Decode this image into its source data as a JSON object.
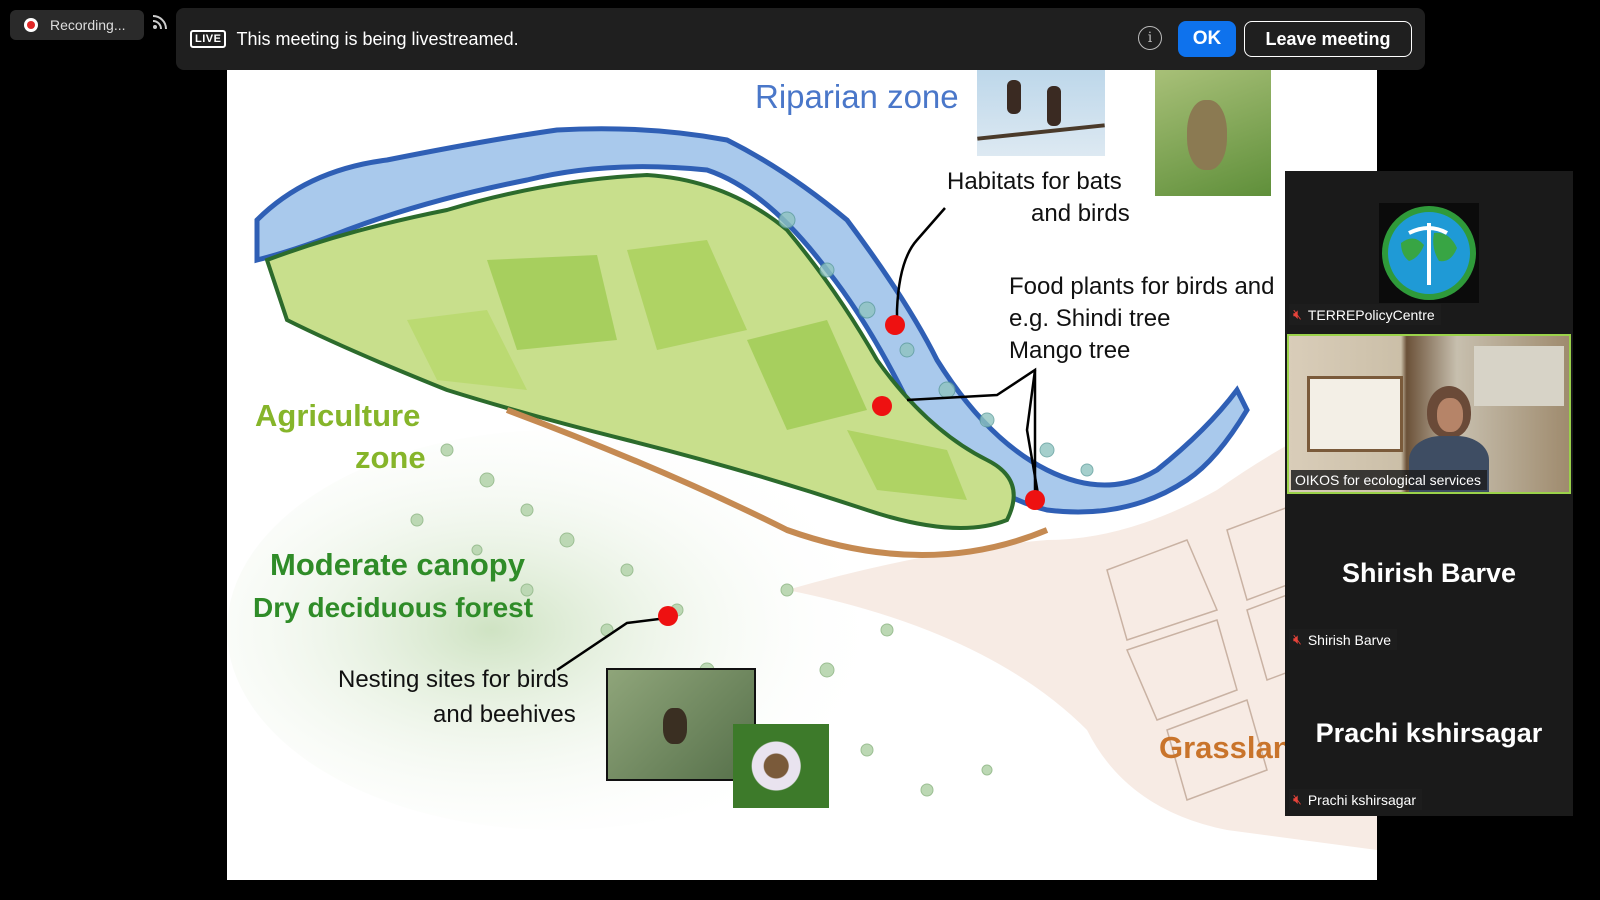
{
  "recording": {
    "label": "Recording..."
  },
  "banner": {
    "badge": "LIVE",
    "message": "This meeting is being livestreamed.",
    "ok_label": "OK",
    "leave_label": "Leave meeting"
  },
  "slide": {
    "riparian": "Riparian zone",
    "habitats_line1": "Habitats for bats",
    "habitats_line2": "and birds",
    "food_line1": "Food plants for birds and",
    "food_line2": "e.g. Shindi tree",
    "food_line3": "Mango tree",
    "agri_line1": "Agriculture",
    "agri_line2": "zone",
    "canopy_line1": "Moderate canopy",
    "canopy_line2": "Dry deciduous forest",
    "nesting_line1": "Nesting sites for birds",
    "nesting_line2": "and beehives",
    "grassland": "Grasslan"
  },
  "participants": [
    {
      "label": "TERREPolicyCentre",
      "muted": true,
      "video": false,
      "avatar": "globe-logo"
    },
    {
      "label": "OIKOS for ecological services",
      "muted": false,
      "video": true,
      "active_speaker": true
    },
    {
      "display_name": "Shirish Barve",
      "label": "Shirish Barve",
      "muted": true,
      "video": false
    },
    {
      "display_name": "Prachi kshirsagar",
      "label": "Prachi kshirsagar",
      "muted": true,
      "video": false
    }
  ],
  "colors": {
    "live_accent": "#0e72ed",
    "active_border": "#9bd24a",
    "muted_icon": "#e8433a"
  }
}
